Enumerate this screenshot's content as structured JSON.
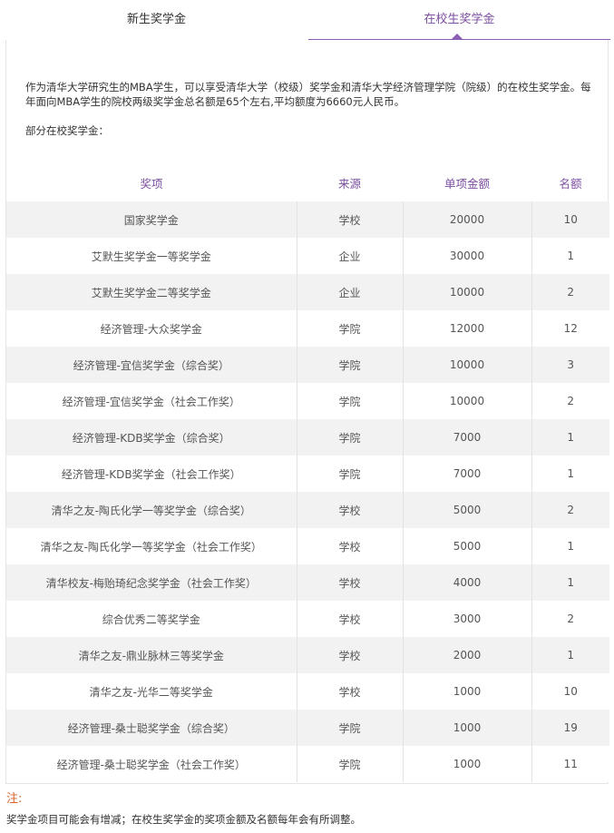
{
  "tabs": [
    {
      "label": "新生奖学金",
      "active": false
    },
    {
      "label": "在校生奖学金",
      "active": true
    }
  ],
  "intro": "作为清华大学研究生的MBA学生，可以享受清华大学（校级）奖学金和清华大学经济管理学院（院级）的在校生奖学金。每年面向MBA学生的院校两级奖学金总名额是65个左右,平均额度为6660元人民币。",
  "section_label": "部分在校奖学金：",
  "table": {
    "headers": [
      "奖项",
      "来源",
      "单项金额",
      "名额"
    ],
    "rows": [
      [
        "国家奖学金",
        "学校",
        "20000",
        "10"
      ],
      [
        "艾默生奖学金一等奖学金",
        "企业",
        "30000",
        "1"
      ],
      [
        "艾默生奖学金二等奖学金",
        "企业",
        "10000",
        "2"
      ],
      [
        "经济管理-大众奖学金",
        "学院",
        "12000",
        "12"
      ],
      [
        "经济管理-宜信奖学金（综合奖）",
        "学院",
        "10000",
        "3"
      ],
      [
        "经济管理-宜信奖学金（社会工作奖）",
        "学院",
        "10000",
        "2"
      ],
      [
        "经济管理-KDB奖学金（综合奖）",
        "学院",
        "7000",
        "1"
      ],
      [
        "经济管理-KDB奖学金（社会工作奖）",
        "学院",
        "7000",
        "1"
      ],
      [
        "清华之友-陶氏化学一等奖学金（综合奖）",
        "学校",
        "5000",
        "2"
      ],
      [
        "清华之友-陶氏化学一等奖学金（社会工作奖）",
        "学校",
        "5000",
        "1"
      ],
      [
        "清华校友-梅贻琦纪念奖学金（社会工作奖）",
        "学校",
        "4000",
        "1"
      ],
      [
        "综合优秀二等奖学金",
        "学校",
        "3000",
        "2"
      ],
      [
        "清华之友-鼎业脉林三等奖学金",
        "学校",
        "2000",
        "1"
      ],
      [
        "清华之友-光华二等奖学金",
        "学校",
        "1000",
        "10"
      ],
      [
        "经济管理-桑士聪奖学金（综合奖）",
        "学院",
        "1000",
        "19"
      ],
      [
        "经济管理-桑士聪奖学金（社会工作奖）",
        "学院",
        "1000",
        "11"
      ]
    ]
  },
  "note": {
    "title": "注:",
    "text": "奖学金项目可能会有增减；在校生奖学金的奖项金额及名额每年会有所调整。"
  },
  "colors": {
    "accent": "#7b4ea0",
    "note": "#d9622b",
    "stripe": "#f2f2f2"
  }
}
